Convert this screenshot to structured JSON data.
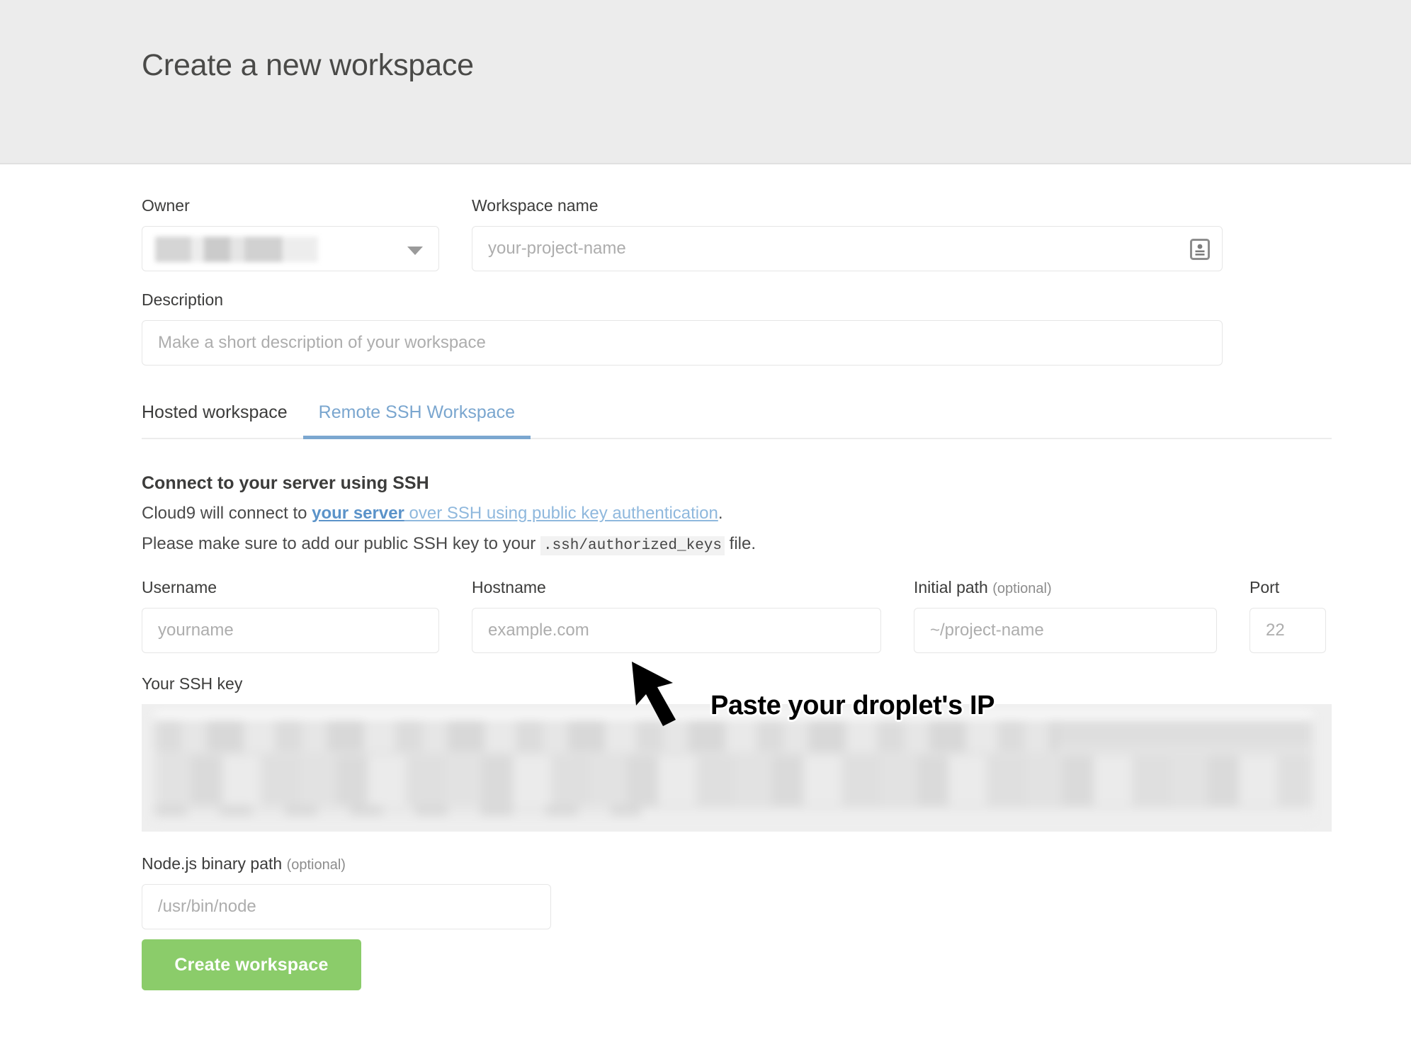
{
  "header": {
    "title": "Create a new workspace"
  },
  "form": {
    "owner": {
      "label": "Owner",
      "value": "",
      "redacted": true
    },
    "workspace_name": {
      "label": "Workspace name",
      "placeholder": "your-project-name",
      "value": "",
      "icon": "contact-card-icon"
    },
    "description": {
      "label": "Description",
      "placeholder": "Make a short description of your workspace",
      "value": ""
    }
  },
  "tabs": [
    {
      "label": "Hosted workspace",
      "active": false
    },
    {
      "label": "Remote SSH Workspace",
      "active": true
    }
  ],
  "ssh": {
    "heading": "Connect to your server using SSH",
    "line1_prefix": "Cloud9 will connect to ",
    "line1_link_strong": "your server",
    "line1_link_soft": " over SSH using public key authentication",
    "line1_suffix": ".",
    "line2_prefix": "Please make sure to add our public SSH key to your ",
    "line2_code": ".ssh/authorized_keys",
    "line2_suffix": " file.",
    "username": {
      "label": "Username",
      "placeholder": "yourname",
      "value": ""
    },
    "hostname": {
      "label": "Hostname",
      "placeholder": "example.com",
      "value": ""
    },
    "initial_path": {
      "label": "Initial path",
      "label_optional": "(optional)",
      "placeholder": "~/project-name",
      "value": ""
    },
    "port": {
      "label": "Port",
      "placeholder": "22",
      "value": ""
    },
    "ssh_key": {
      "label": "Your SSH key",
      "value": "",
      "redacted": true
    }
  },
  "node": {
    "label": "Node.js binary path",
    "label_optional": "(optional)",
    "placeholder": "/usr/bin/node",
    "value": ""
  },
  "actions": {
    "create_label": "Create workspace"
  },
  "annotation": {
    "text": "Paste your droplet's IP"
  },
  "colors": {
    "header_bg": "#ececec",
    "tab_active": "#7ba7d0",
    "link_strong": "#5b93c9",
    "link_soft": "#8fb8dd",
    "create_button": "#8bcc6a",
    "text": "#3c3c3b"
  }
}
